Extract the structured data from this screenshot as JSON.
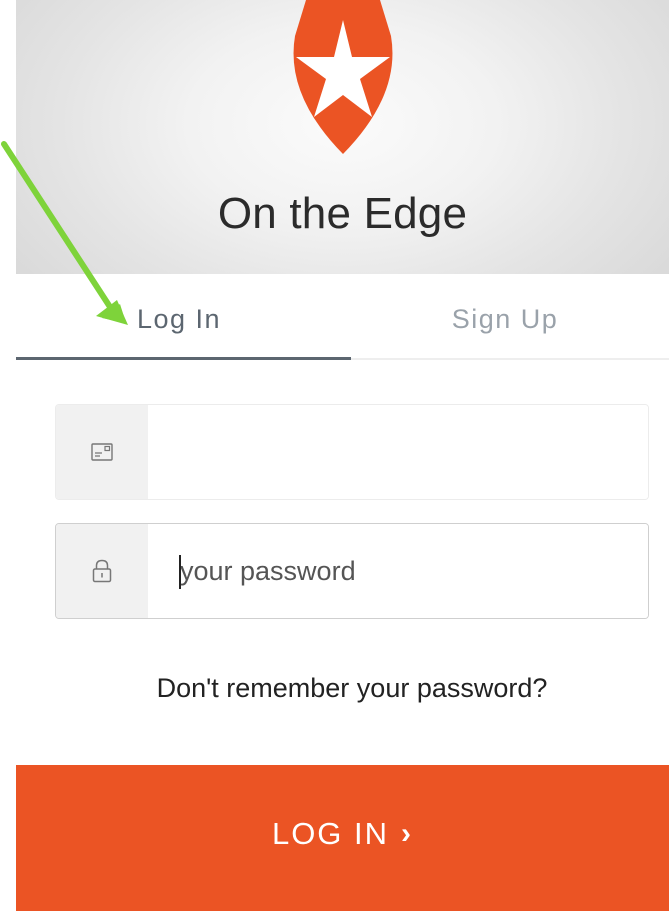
{
  "header": {
    "title": "On the Edge",
    "logo_icon": "shield-star-icon",
    "logo_color": "#eb5424"
  },
  "tabs": [
    {
      "label": "Log In",
      "active": true
    },
    {
      "label": "Sign Up",
      "active": false
    }
  ],
  "form": {
    "email": {
      "icon": "email-icon",
      "value": "",
      "placeholder": ""
    },
    "password": {
      "icon": "lock-icon",
      "value": "",
      "placeholder": "your password"
    },
    "forgot_label": "Don't remember your password?",
    "submit_label": "LOG IN",
    "submit_icon": "chevron-right-icon"
  },
  "annotation": {
    "arrow_icon": "arrow-icon",
    "color": "#7ed33a"
  },
  "colors": {
    "accent": "#eb5424",
    "tab_active": "#5c6670",
    "tab_inactive": "#9aa2aa"
  }
}
